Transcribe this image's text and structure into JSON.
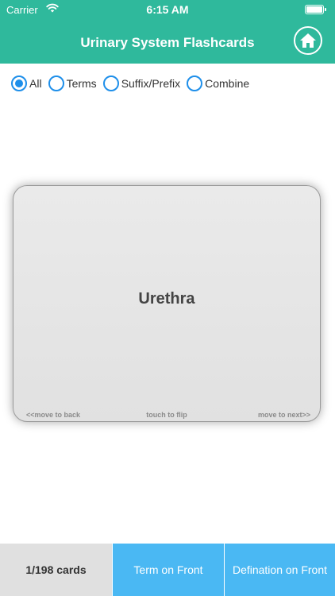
{
  "status_bar": {
    "carrier": "Carrier",
    "time": "6:15 AM"
  },
  "navbar": {
    "title": "Urinary System Flashcards",
    "home_icon": "home-icon"
  },
  "filters": [
    {
      "label": "All",
      "selected": true
    },
    {
      "label": "Terms",
      "selected": false
    },
    {
      "label": "Suffix/Prefix",
      "selected": false
    },
    {
      "label": "Combine",
      "selected": false
    }
  ],
  "card": {
    "term": "Urethra",
    "hint_back": "<<move to back",
    "hint_flip": "touch to flip",
    "hint_next": "move to next>>"
  },
  "bottom": {
    "count": "1/198 cards",
    "term_front": "Term on Front",
    "def_front": "Defination on Front"
  },
  "colors": {
    "brand": "#2fb99c",
    "accent": "#4ab8f3",
    "radio": "#1e8fea"
  }
}
